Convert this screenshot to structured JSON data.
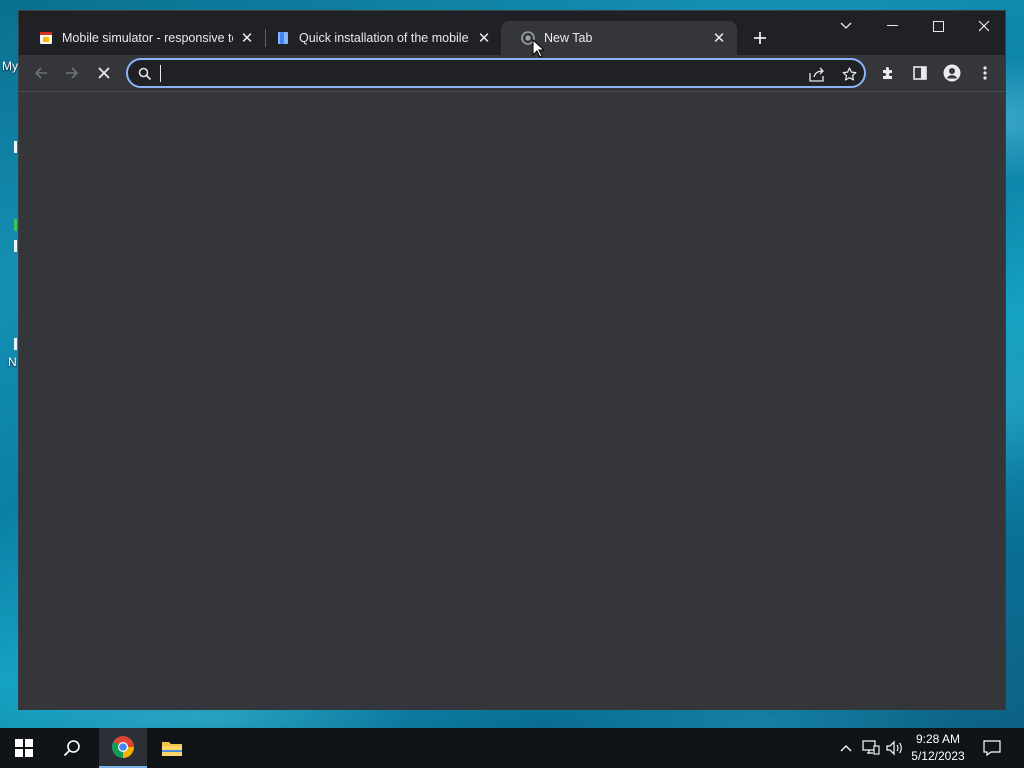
{
  "desktop": {
    "icon_labels": [
      "My",
      "N"
    ]
  },
  "browser": {
    "tabs": [
      {
        "title": "Mobile simulator - responsive te",
        "favicon": "mobile-simulator-favicon",
        "active": false
      },
      {
        "title": "Quick installation of the mobile s",
        "favicon": "document-favicon",
        "active": false
      },
      {
        "title": "New Tab",
        "favicon": "chrome-newtab-favicon",
        "active": true
      }
    ],
    "new_tab_icon": "plus-icon",
    "window_controls": [
      "tab-search-chevron-icon",
      "minimize-icon",
      "maximize-icon",
      "close-window-icon"
    ],
    "toolbar": {
      "back_icon": "back-arrow-icon",
      "forward_icon": "forward-arrow-icon",
      "stop_icon": "stop-loading-icon",
      "omnibox": {
        "value": "",
        "placeholder": "",
        "icon": "search-icon"
      },
      "omnibox_actions": [
        "share-icon",
        "bookmark-star-icon"
      ],
      "right_icons": [
        "extensions-puzzle-icon",
        "side-panel-icon",
        "profile-icon",
        "kebab-menu-icon"
      ]
    },
    "colors": {
      "frame": "#202124",
      "toolbar": "#35363a",
      "focus_ring": "#8ab4f8",
      "text": "#e8eaed"
    }
  },
  "taskbar": {
    "items": [
      "windows-start-icon",
      "search-icon",
      "chrome-icon",
      "file-explorer-icon"
    ],
    "active_item": "chrome-icon",
    "tray_icons": [
      "show-hidden-chevron-icon",
      "network-icon",
      "volume-icon",
      "notification-icon"
    ],
    "time": "9:28 AM",
    "date": "5/12/2023"
  }
}
